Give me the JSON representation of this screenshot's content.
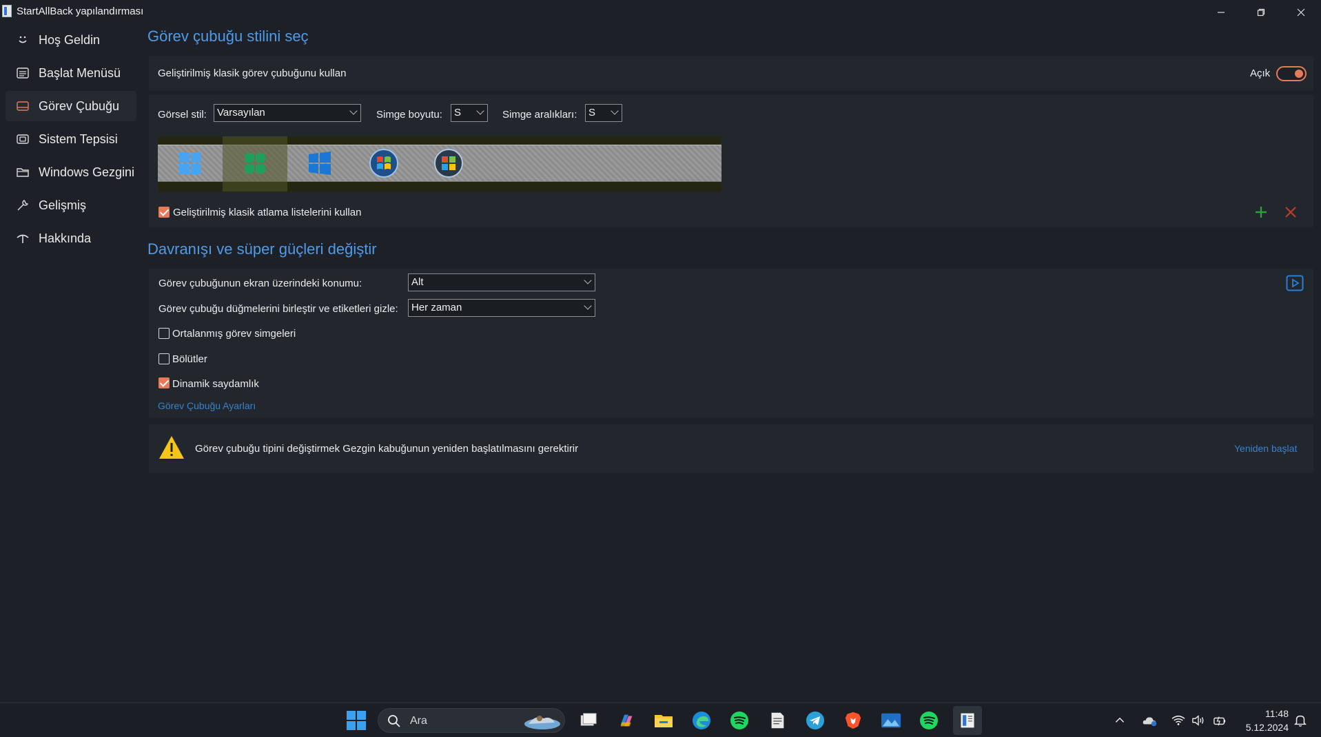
{
  "window": {
    "title": "StartAllBack yapılandırması"
  },
  "sidebar": {
    "items": [
      {
        "label": "Hoş Geldin",
        "icon": "smile-icon"
      },
      {
        "label": "Başlat Menüsü",
        "icon": "start-menu-icon"
      },
      {
        "label": "Görev Çubuğu",
        "icon": "taskbar-icon",
        "active": true
      },
      {
        "label": "Sistem Tepsisi",
        "icon": "system-tray-icon"
      },
      {
        "label": "Windows Gezgini",
        "icon": "folder-icon"
      },
      {
        "label": "Gelişmiş",
        "icon": "wrench-icon"
      },
      {
        "label": "Hakkında",
        "icon": "about-icon"
      }
    ]
  },
  "section1": {
    "title": "Görev çubuğu stilini seç",
    "classic_label": "Geliştirilmiş klasik görev çubuğunu kullan",
    "toggle_label": "Açık",
    "visual_style_label": "Görsel stil:",
    "visual_style_value": "Varsayılan",
    "icon_size_label": "Simge boyutu:",
    "icon_size_value": "S",
    "icon_spacing_label": "Simge aralıkları:",
    "icon_spacing_value": "S",
    "jumplist_label": "Geliştirilmiş klasik atlama listelerini kullan"
  },
  "section2": {
    "title": "Davranışı ve süper güçleri değiştir",
    "position_label": "Görev çubuğunun ekran üzerindeki konumu:",
    "position_value": "Alt",
    "combine_label": "Görev çubuğu düğmelerini birleştir ve etiketleri gizle:",
    "combine_value": "Her zaman",
    "centered_label": "Ortalanmış görev simgeleri",
    "segments_label": "Bölütler",
    "dynamic_label": "Dinamik saydamlık",
    "settings_link": "Görev Çubuğu Ayarları"
  },
  "warning": {
    "text": "Görev çubuğu tipini değiştirmek Gezgin kabuğunun yeniden başlatılmasını gerektirir",
    "restart_link": "Yeniden başlat"
  },
  "taskbar": {
    "search_placeholder": "Ara",
    "time": "11:48",
    "date": "5.12.2024"
  },
  "colors": {
    "accent": "#e67a5a",
    "heading": "#4f9be8",
    "link": "#3d80c7",
    "add": "#2e9e3a",
    "remove": "#c0392b"
  }
}
